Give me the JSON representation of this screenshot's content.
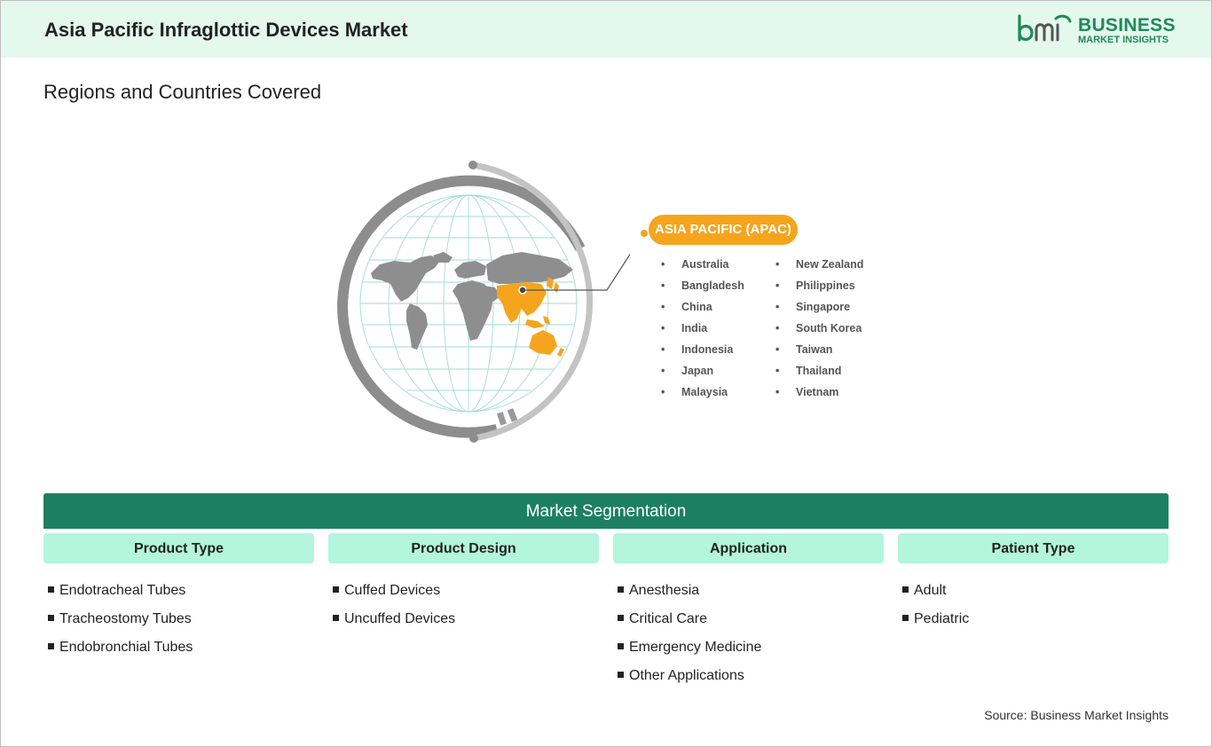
{
  "header": {
    "title": "Asia Pacific Infraglottic Devices Market",
    "logo": {
      "mark": "bmi",
      "line1": "BUSINESS",
      "line2": "MARKET INSIGHTS",
      "color": "#1e8a55"
    }
  },
  "section_title": "Regions and Countries Covered",
  "map": {
    "icon": "globe-world-map-icon",
    "highlight_color": "#f5a41d",
    "region": "ASIA PACIFIC (APAC)",
    "countries_col1": [
      "Australia",
      "Bangladesh",
      "China",
      "India",
      "Indonesia",
      "Japan",
      "Malaysia"
    ],
    "countries_col2": [
      "New Zealand",
      "Philippines",
      "Singapore",
      "South Korea",
      "Taiwan",
      "Thailand",
      "Vietnam"
    ]
  },
  "segmentation": {
    "title": "Market Segmentation",
    "accent": "#1c8060",
    "columns": [
      {
        "title": "Product Type",
        "items": [
          "Endotracheal Tubes",
          "Tracheostomy Tubes",
          "Endobronchial Tubes"
        ]
      },
      {
        "title": "Product Design",
        "items": [
          "Cuffed Devices",
          "Uncuffed Devices"
        ]
      },
      {
        "title": "Application",
        "items": [
          "Anesthesia",
          "Critical Care",
          "Emergency Medicine",
          "Other Applications"
        ]
      },
      {
        "title": "Patient Type",
        "items": [
          "Adult",
          "Pediatric"
        ]
      }
    ]
  },
  "source": "Source: Business Market Insights"
}
